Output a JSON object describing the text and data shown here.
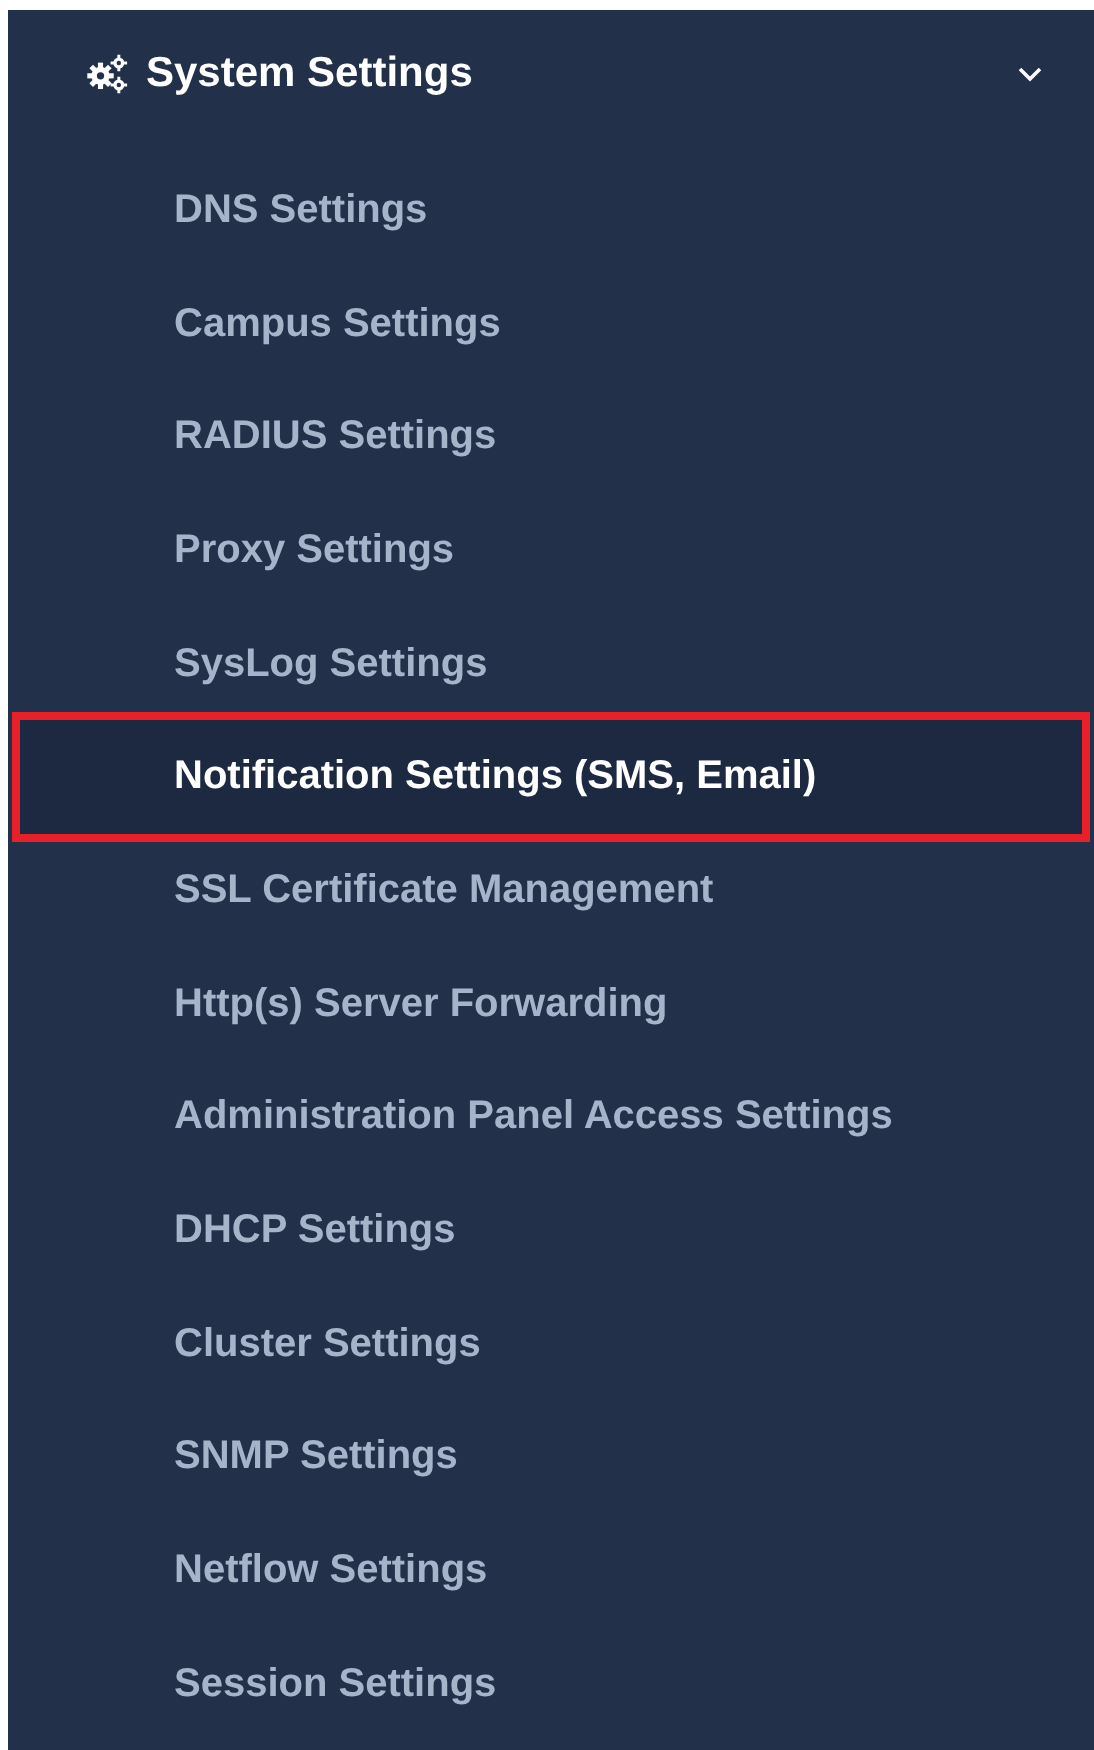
{
  "menu": {
    "title": "System Settings",
    "expanded": true,
    "items": [
      {
        "label": "DNS Settings",
        "selected": false
      },
      {
        "label": "Campus Settings",
        "selected": false
      },
      {
        "label": "RADIUS Settings",
        "selected": false
      },
      {
        "label": "Proxy Settings",
        "selected": false
      },
      {
        "label": "SysLog Settings",
        "selected": false
      },
      {
        "label": "Notification Settings (SMS, Email)",
        "selected": true
      },
      {
        "label": "SSL Certificate Management",
        "selected": false
      },
      {
        "label": "Http(s) Server Forwarding",
        "selected": false
      },
      {
        "label": "Administration Panel Access Settings",
        "selected": false
      },
      {
        "label": "DHCP Settings",
        "selected": false
      },
      {
        "label": "Cluster Settings",
        "selected": false
      },
      {
        "label": "SNMP Settings",
        "selected": false
      },
      {
        "label": "Netflow Settings",
        "selected": false
      },
      {
        "label": "Session Settings",
        "selected": false
      }
    ]
  }
}
